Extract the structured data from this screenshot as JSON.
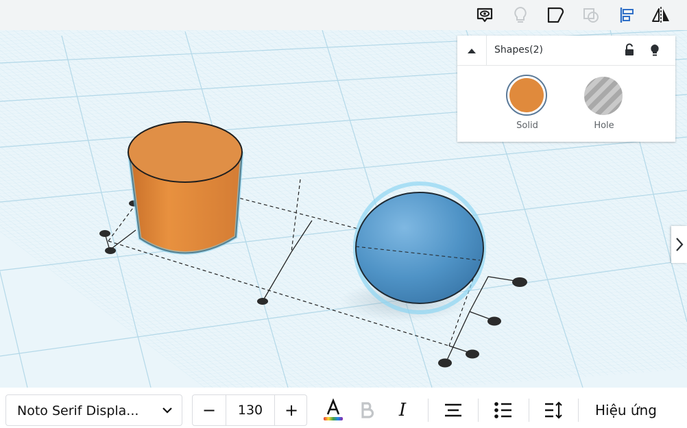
{
  "toolbar": {
    "icons": [
      "show-all-eye-icon",
      "hint-lightbulb-icon",
      "group-shapes-icon",
      "ungroup-shapes-icon",
      "align-icon",
      "mirror-icon"
    ]
  },
  "inspector": {
    "title": "Shapes(2)",
    "solid_label": "Solid",
    "hole_label": "Hole",
    "solid_color": "#e08a3c"
  },
  "scene": {
    "grid_color": "#d6ecf5",
    "cylinder_color": "#e3893a",
    "sphere_color": "#5b9fd0"
  },
  "text_toolbar": {
    "font_name": "Noto Serif Displa...",
    "font_size": "130",
    "minus_label": "−",
    "plus_label": "+",
    "italic_label": "I",
    "effects_label": "Hiệu ứng"
  }
}
